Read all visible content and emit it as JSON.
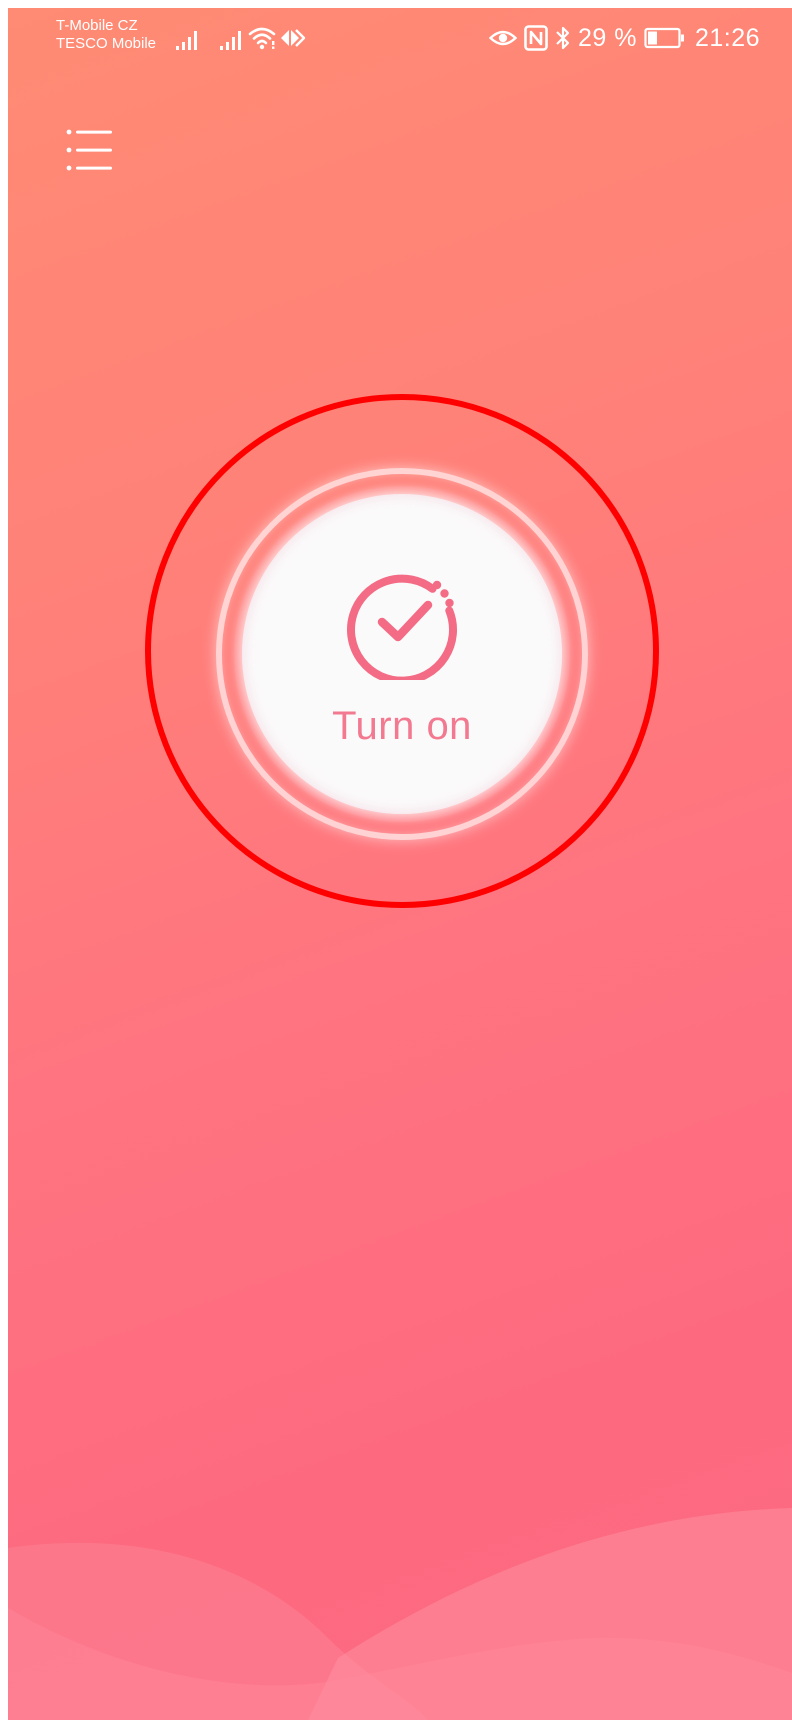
{
  "status_bar": {
    "carrier_1": "T-Mobile CZ",
    "carrier_2": "TESCO Mobile",
    "battery_percent": "29 %",
    "time": "21:26",
    "icons": [
      "signal-icon",
      "signal-icon",
      "wifi-icon",
      "data-transfer-icon",
      "eye-comfort-icon",
      "nfc-icon",
      "bluetooth-icon",
      "battery-icon"
    ]
  },
  "toolbar": {
    "menu_icon": "menu-icon"
  },
  "main": {
    "power_button": {
      "label": "Turn on",
      "icon": "check-circle-icon"
    }
  },
  "colors": {
    "background_top": "#ff8b74",
    "background_bottom": "#fc6a82",
    "button_face": "#fbfafb",
    "accent": "#f2798f",
    "highlight_ring": "#ff0000"
  }
}
